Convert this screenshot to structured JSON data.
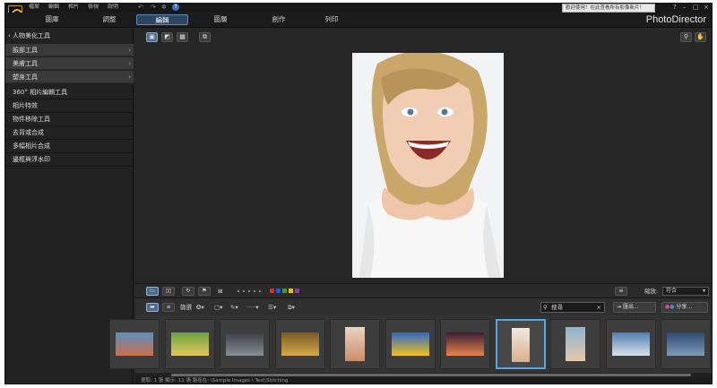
{
  "menu": {
    "items": [
      "檔案",
      "編輯",
      "相片",
      "檢視",
      "說明"
    ]
  },
  "notice": "歡迎使用！在此查看所有影像新片！",
  "tabs": [
    {
      "label": "圖庫",
      "active": false
    },
    {
      "label": "調整",
      "active": false
    },
    {
      "label": "編輯",
      "active": true
    },
    {
      "label": "圖層",
      "active": false
    },
    {
      "label": "創作",
      "active": false
    },
    {
      "label": "列印",
      "active": false
    }
  ],
  "brand": "PhotoDirector",
  "left_panel": {
    "header": "人物美化工具",
    "sub_groups": [
      "臉部工具",
      "美膚工具",
      "塑身工具"
    ],
    "items": [
      "360° 相片編輯工具",
      "相片特效",
      "物件移除工具",
      "去背或合成",
      "多幅相片合成",
      "邊框與浮水印"
    ]
  },
  "toolbar": {
    "zoom_label": "縮放:",
    "zoom_value": "符合",
    "view_label": "篩選",
    "search_placeholder": "搜尋",
    "export_label": "匯出...",
    "share_label": "分享..."
  },
  "color_labels": [
    "#d8302a",
    "#2f58c9",
    "#3a9c3a",
    "#d9c52b",
    "#8b3aa8"
  ],
  "thumbnails": [
    {
      "subject": "waterfront-dusk",
      "colors": [
        "#5c8fbf",
        "#c9704a"
      ]
    },
    {
      "subject": "bicycle-field",
      "colors": [
        "#6aa343",
        "#e5c65b"
      ]
    },
    {
      "subject": "dark-tunnel",
      "colors": [
        "#3a3f47",
        "#8a8f96"
      ]
    },
    {
      "subject": "spiral-staircase",
      "colors": [
        "#7a5a22",
        "#d6a94a"
      ]
    },
    {
      "subject": "smiling-woman",
      "colors": [
        "#e9d3c2",
        "#c98e6a"
      ]
    },
    {
      "subject": "sunflower-sky",
      "colors": [
        "#2b67c8",
        "#f2c21d"
      ]
    },
    {
      "subject": "sunset-sea",
      "colors": [
        "#3a1e34",
        "#e8834a"
      ]
    },
    {
      "subject": "woman-portrait-selected",
      "colors": [
        "#f0e8e0",
        "#d9b08c"
      ]
    },
    {
      "subject": "smiling-girl-2",
      "colors": [
        "#8fb3cf",
        "#e3c9a8"
      ]
    },
    {
      "subject": "mountain-lake",
      "colors": [
        "#4f7fb0",
        "#d8dfe8"
      ]
    },
    {
      "subject": "city-skyline",
      "colors": [
        "#2d4a6e",
        "#7f9bb8"
      ]
    }
  ],
  "status": "選取: 1 張   顯示: 11 張              路徑在: \\Sample Images \\ Test\\Stitching"
}
